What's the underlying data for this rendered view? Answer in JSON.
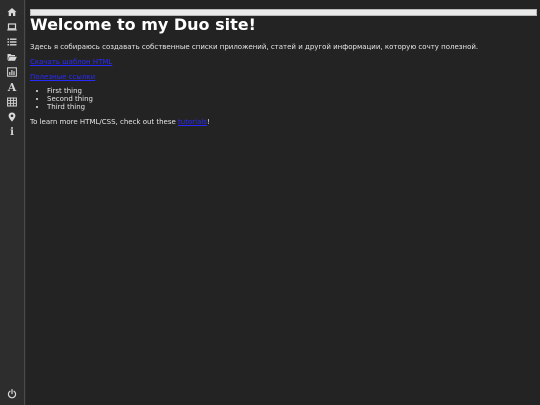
{
  "sidebar": {
    "items": [
      {
        "icon": "home-icon"
      },
      {
        "icon": "laptop-icon"
      },
      {
        "icon": "list-icon"
      },
      {
        "icon": "folder-open-icon"
      },
      {
        "icon": "bar-chart-icon"
      },
      {
        "icon": "font-icon",
        "glyph": "A"
      },
      {
        "icon": "table-icon"
      },
      {
        "icon": "map-marker-icon"
      },
      {
        "icon": "info-icon",
        "glyph": "i"
      }
    ],
    "bottom": {
      "icon": "power-icon"
    }
  },
  "main": {
    "title": "Welcome to my Duo site!",
    "intro": "Здесь я собираюсь создавать собственные списки приложений, статей и другой информации, которую сочту полезной.",
    "link1": "Скачать шаблон HTML",
    "link2": "Полезные ссылки",
    "list": [
      "First thing",
      "Second thing",
      "Third thing"
    ],
    "outro_before": "To learn more HTML/CSS, check out these ",
    "outro_link": "tutorials",
    "outro_after": "!"
  },
  "colors": {
    "background": "#232323",
    "sidebar": "#2d2d2d",
    "link": "#2a2aff"
  }
}
